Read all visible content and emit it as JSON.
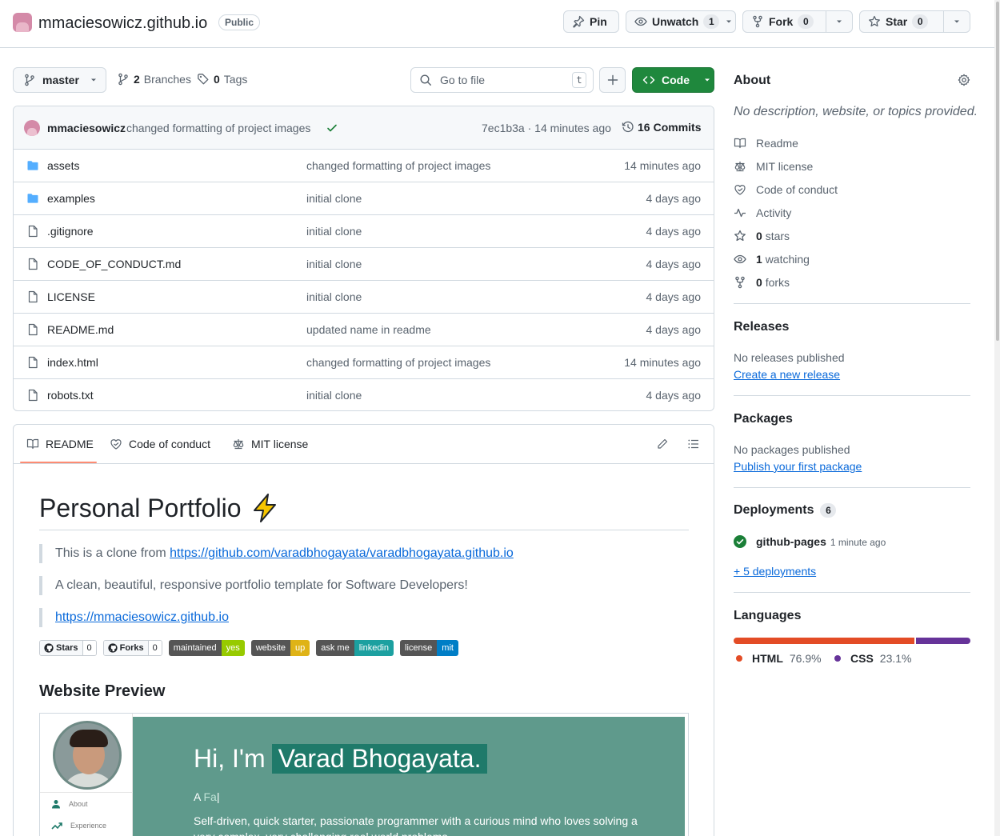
{
  "repo": {
    "name": "mmaciesowicz.github.io",
    "visibility": "Public"
  },
  "header_actions": {
    "pin_label": "Pin",
    "unwatch_label": "Unwatch",
    "unwatch_count": "1",
    "fork_label": "Fork",
    "fork_count": "0",
    "star_label": "Star",
    "star_count": "0"
  },
  "toolbar": {
    "branch": "master",
    "branches_count": "2",
    "branches_label": "Branches",
    "tags_count": "0",
    "tags_label": "Tags",
    "goto_placeholder": "Go to file",
    "goto_shortcut": "t",
    "code_label": "Code"
  },
  "latest_commit": {
    "author": "mmaciesowicz",
    "message": "changed formatting of project images",
    "hash_time": "7ec1b3a · 14 minutes ago",
    "commits_count": "16",
    "commits_label": "Commits"
  },
  "files": [
    {
      "name": "assets",
      "type": "folder",
      "message": "changed formatting of project images",
      "date": "14 minutes ago"
    },
    {
      "name": "examples",
      "type": "folder",
      "message": "initial clone",
      "date": "4 days ago"
    },
    {
      "name": ".gitignore",
      "type": "file",
      "message": "initial clone",
      "date": "4 days ago"
    },
    {
      "name": "CODE_OF_CONDUCT.md",
      "type": "file",
      "message": "initial clone",
      "date": "4 days ago"
    },
    {
      "name": "LICENSE",
      "type": "file",
      "message": "initial clone",
      "date": "4 days ago"
    },
    {
      "name": "README.md",
      "type": "file",
      "message": "updated name in readme",
      "date": "4 days ago"
    },
    {
      "name": "index.html",
      "type": "file",
      "message": "changed formatting of project images",
      "date": "14 minutes ago"
    },
    {
      "name": "robots.txt",
      "type": "file",
      "message": "initial clone",
      "date": "4 days ago"
    }
  ],
  "readme_tabs": {
    "readme": "README",
    "conduct": "Code of conduct",
    "license": "MIT license"
  },
  "readme": {
    "title": "Personal Portfolio",
    "quote1_prefix": "This is a clone from ",
    "quote1_link": "https://github.com/varadbhogayata/varadbhogayata.github.io",
    "quote2": "A clean, beautiful, responsive portfolio template for Software Developers!",
    "quote3_link": "https://mmaciesowicz.github.io",
    "badges": {
      "stars_label": "Stars",
      "stars_count": "0",
      "forks_label": "Forks",
      "forks_count": "0",
      "maintained_l": "maintained",
      "maintained_r": "yes",
      "website_l": "website",
      "website_r": "up",
      "askme_l": "ask me",
      "askme_r": "linkedin",
      "license_l": "license",
      "license_r": "mit"
    },
    "preview_heading": "Website Preview",
    "preview": {
      "nav_about": "About",
      "nav_experience": "Experience",
      "hi_prefix": "Hi, I'm",
      "hi_name": "Varad Bhogayata.",
      "sub_prefix": "A ",
      "sub_typed": "Fa",
      "desc": "Self-driven, quick starter, passionate programmer with a curious mind who loves solving a very complex, very challenging real world problems."
    }
  },
  "sidebar": {
    "about_title": "About",
    "description": "No description, website, or topics provided.",
    "readme": "Readme",
    "license": "MIT license",
    "conduct": "Code of conduct",
    "activity": "Activity",
    "stars_count": "0",
    "stars_label": "stars",
    "watching_count": "1",
    "watching_label": "watching",
    "forks_count": "0",
    "forks_label": "forks",
    "releases_title": "Releases",
    "releases_none": "No releases published",
    "releases_link": "Create a new release",
    "packages_title": "Packages",
    "packages_none": "No packages published",
    "packages_link": "Publish your first package",
    "deployments_title": "Deployments",
    "deployments_count": "6",
    "deploy_name": "github-pages",
    "deploy_time": "1 minute ago",
    "deploy_more": "+ 5 deployments",
    "languages_title": "Languages",
    "languages": [
      {
        "name": "HTML",
        "percent": "76.9%",
        "value": 76.9,
        "color": "#e34c26"
      },
      {
        "name": "CSS",
        "percent": "23.1%",
        "value": 23.1,
        "color": "#663399"
      }
    ]
  },
  "colors": {
    "accent": "#0969da",
    "code_button": "#1f883d",
    "success": "#1a7f37",
    "tab_underline": "#fd8c73",
    "badge_yes": "#97ca00",
    "badge_up": "#dfb317",
    "badge_linkedin": "#1ca0a0",
    "badge_mit": "#007ec6"
  }
}
